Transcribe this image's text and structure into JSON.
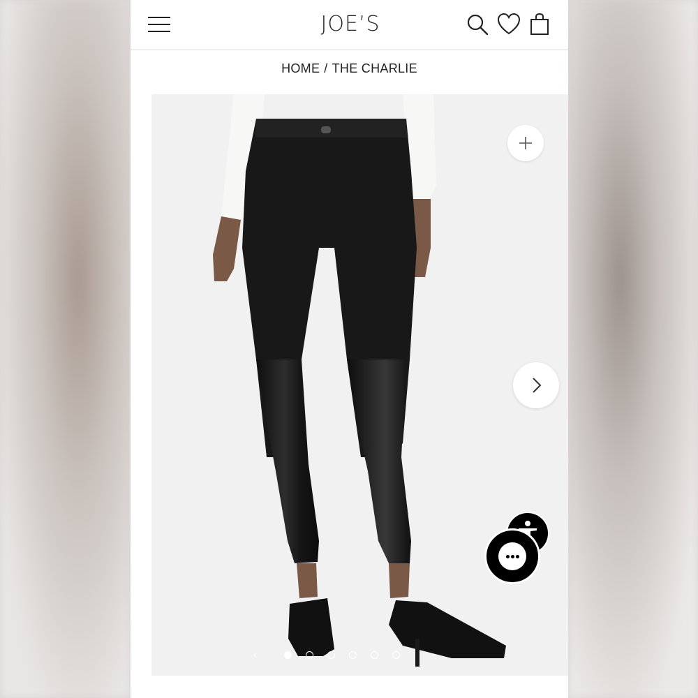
{
  "header": {
    "logo": "JOE’S",
    "menu_icon": "hamburger-menu-icon",
    "search_icon": "search-icon",
    "wishlist_icon": "heart-icon",
    "bag_icon": "shopping-bag-icon"
  },
  "breadcrumb": {
    "home": "HOME",
    "separator": "/",
    "current": "THE CHARLIE"
  },
  "gallery": {
    "image_count": 6,
    "active_index": 0,
    "zoom_icon": "plus-icon",
    "next_icon": "chevron-right-icon",
    "prev_small": "‹",
    "next_small": "›"
  },
  "widgets": {
    "accessibility_icon": "accessibility-person-icon",
    "chat_icon": "chat-bubble-icon"
  },
  "colors": {
    "background": "#ffffff",
    "text": "#222222",
    "image_bg": "#f1f1f1",
    "pants": "#1b1b1b",
    "widget": "#000000"
  }
}
